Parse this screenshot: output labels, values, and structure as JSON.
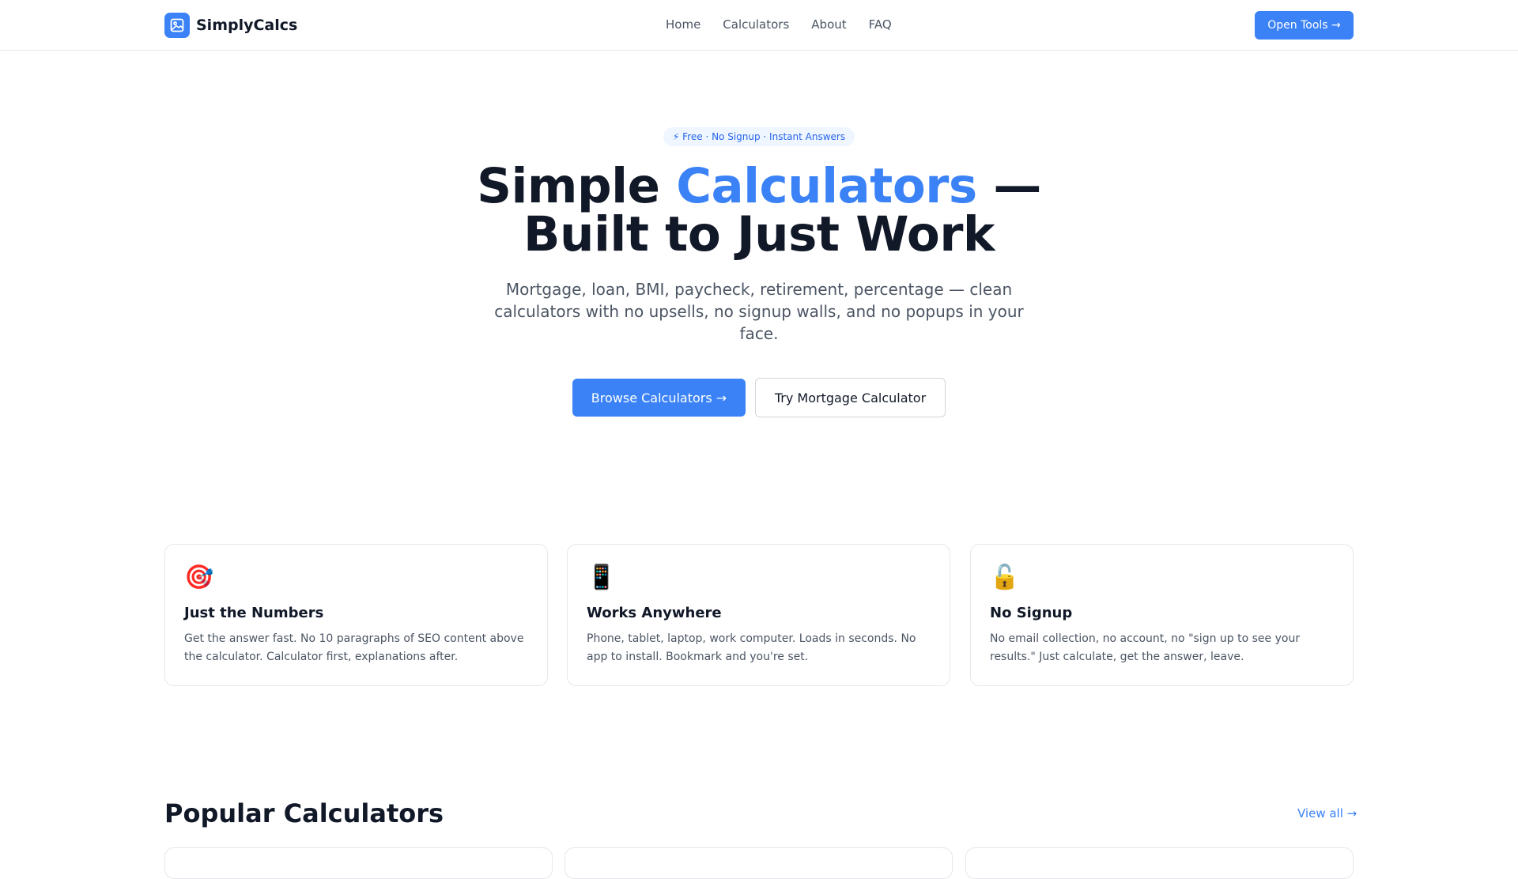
{
  "header": {
    "brand": "SimplyCalcs",
    "nav": [
      "Home",
      "Calculators",
      "About",
      "FAQ"
    ],
    "cta": "Open Tools →"
  },
  "hero": {
    "badge": "⚡ Free · No Signup · Instant Answers",
    "title_part1": "Simple ",
    "title_accent": "Calculators",
    "title_part2": " —",
    "title_line2": "Built to Just Work",
    "subtitle": "Mortgage, loan, BMI, paycheck, retirement, percentage — clean calculators with no upsells, no signup walls, and no popups in your face.",
    "primary_button": "Browse Calculators →",
    "secondary_button": "Try Mortgage Calculator"
  },
  "features": [
    {
      "icon": "🎯",
      "icon_name": "target-icon",
      "title": "Just the Numbers",
      "desc": "Get the answer fast. No 10 paragraphs of SEO content above the calculator. Calculator first, explanations after."
    },
    {
      "icon": "📱",
      "icon_name": "mobile-phone-icon",
      "title": "Works Anywhere",
      "desc": "Phone, tablet, laptop, work computer. Loads in seconds. No app to install. Bookmark and you're set."
    },
    {
      "icon": "🔓",
      "icon_name": "unlocked-icon",
      "title": "No Signup",
      "desc": "No email collection, no account, no \"sign up to see your results.\" Just calculate, get the answer, leave."
    }
  ],
  "popular": {
    "title": "Popular Calculators",
    "view_all": "View all →"
  },
  "colors": {
    "accent": "#3b82f6",
    "text": "#111827",
    "muted": "#4b5563",
    "border": "#e5e7eb"
  }
}
